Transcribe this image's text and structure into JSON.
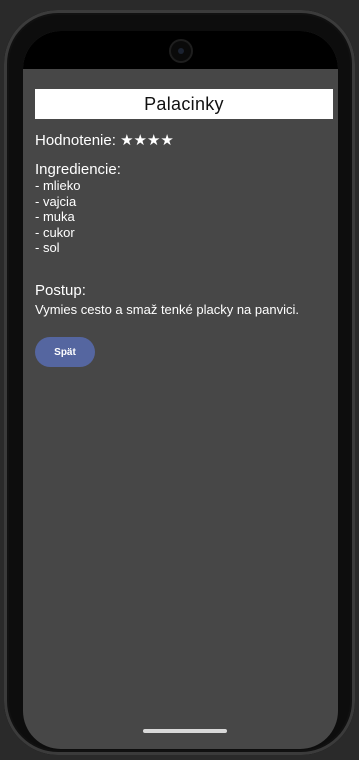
{
  "recipe": {
    "title": "Palacinky",
    "rating_label": "Hodnotenie:",
    "rating_stars": "★★★★",
    "ingredients_title": "Ingrediencie:",
    "ingredients": [
      "- mlieko",
      "- vajcia",
      "- muka",
      "- cukor",
      "- sol"
    ],
    "steps_title": "Postup:",
    "steps_text": "Vymies cesto a smaž tenké placky na panvici."
  },
  "actions": {
    "back_label": "Spät"
  },
  "colors": {
    "screen_background": "#474747",
    "title_background": "#ffffff",
    "button_color": "#5566a0"
  }
}
